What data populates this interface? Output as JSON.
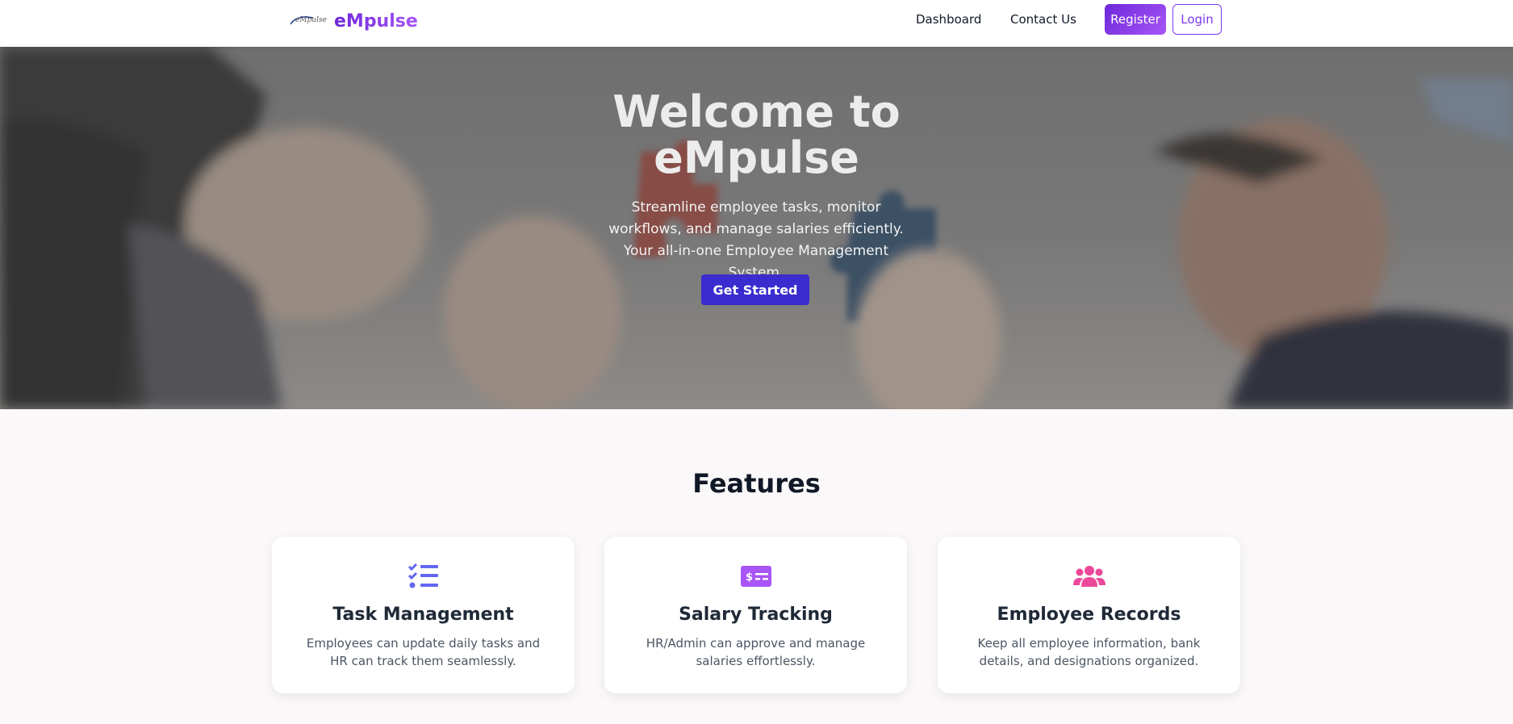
{
  "nav": {
    "logo_text": "eMpulse",
    "brand": "eMpulse",
    "links": [
      "Dashboard",
      "Contact Us"
    ],
    "register": "Register",
    "login": "Login"
  },
  "hero": {
    "title_line1": "Welcome to",
    "title_line2": "eMpulse",
    "subtitle": "Streamline employee tasks, monitor workflows, and manage salaries efficiently. Your all-in-one Employee Management System.",
    "cta": "Get Started"
  },
  "features": {
    "heading": "Features",
    "cards": [
      {
        "icon": "task-list-icon",
        "title": "Task Management",
        "desc": "Employees can update daily tasks and HR can track them seamlessly.",
        "color": "#6366f1"
      },
      {
        "icon": "money-check-icon",
        "title": "Salary Tracking",
        "desc": "HR/Admin can approve and manage salaries effortlessly.",
        "color": "#a855f7"
      },
      {
        "icon": "users-icon",
        "title": "Employee Records",
        "desc": "Keep all employee information, bank details, and designations organized.",
        "color": "#ec4899"
      }
    ]
  },
  "colors": {
    "brand_purple": "#7c3aed",
    "cta_blue": "#3a2ccf"
  }
}
